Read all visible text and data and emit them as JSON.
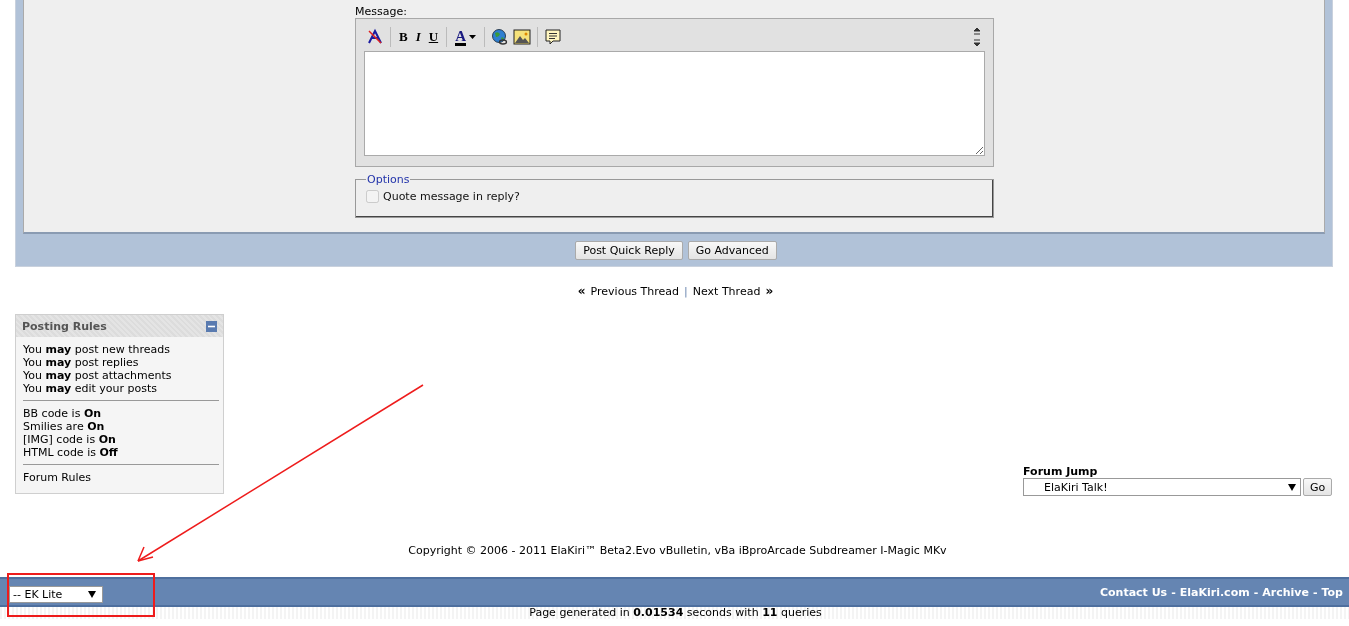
{
  "quick_reply": {
    "message_label": "Message:",
    "toolbar": [
      {
        "kind": "remove_format"
      },
      {
        "kind": "separator"
      },
      {
        "kind": "bold",
        "label": "B"
      },
      {
        "kind": "italic",
        "label": "I"
      },
      {
        "kind": "underline",
        "label": "U"
      },
      {
        "kind": "separator"
      },
      {
        "kind": "font_color",
        "label": "A"
      },
      {
        "kind": "separator"
      },
      {
        "kind": "link"
      },
      {
        "kind": "image"
      },
      {
        "kind": "separator"
      },
      {
        "kind": "quote"
      }
    ],
    "options_legend": "Options",
    "quote_option": {
      "label": "Quote message in reply?",
      "checked": false,
      "disabled": true
    },
    "buttons": [
      "Post Quick Reply",
      "Go Advanced"
    ]
  },
  "thread_nav": {
    "prev_mark": "«",
    "prev": "Previous Thread",
    "divider": "|",
    "next": "Next Thread",
    "next_mark": "»"
  },
  "posting_rules": {
    "title": "Posting Rules",
    "expanded": true,
    "permissions": [
      "You **may** post new threads",
      "You **may** post replies",
      "You **may** post attachments",
      "You **may** edit your posts"
    ],
    "settings": [
      "BB code is **On**",
      "Smilies are **On**",
      "[IMG] code is **On**",
      "HTML code is **Off**"
    ],
    "link": "Forum Rules"
  },
  "forum_jump": {
    "label": "Forum Jump",
    "value": "ElaKiri Talk!",
    "button": "Go"
  },
  "copyright": "Copyright © 2006 - 2011 ElaKiri™ Beta2.Evo vBulletin, vBa iBproArcade Subdreamer I-Magic MKv",
  "footer": {
    "style_select": "-- EK Lite",
    "links": [
      "Contact Us",
      "ElaKiri.com",
      "Archive",
      "Top"
    ],
    "separators": [
      "-",
      "-",
      "-"
    ]
  },
  "page_stats": "Page generated in **0.01534** seconds with **11** queries"
}
